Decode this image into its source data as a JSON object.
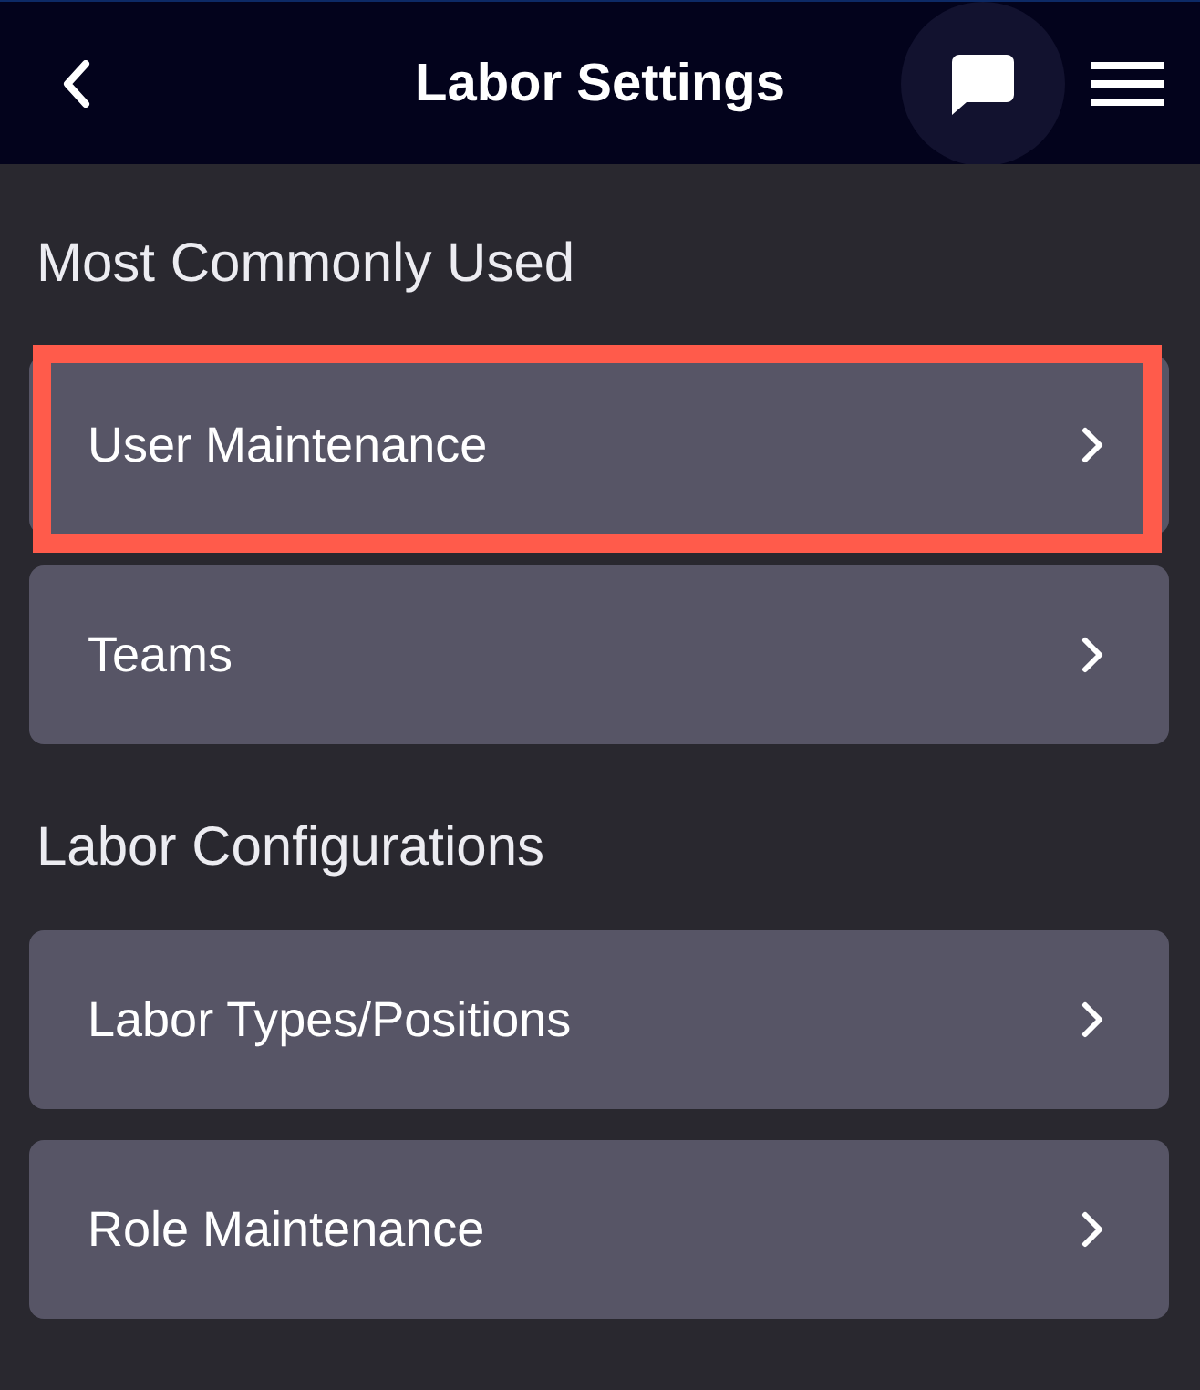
{
  "header": {
    "title": "Labor Settings",
    "chat_button": {
      "focused": true
    }
  },
  "sections": [
    {
      "title": "Most Commonly Used",
      "items": [
        {
          "label": "User Maintenance",
          "highlighted": true
        },
        {
          "label": "Teams",
          "highlighted": false
        }
      ]
    },
    {
      "title": "Labor Configurations",
      "items": [
        {
          "label": "Labor Types/Positions",
          "highlighted": false
        },
        {
          "label": "Role Maintenance",
          "highlighted": false
        }
      ]
    }
  ]
}
